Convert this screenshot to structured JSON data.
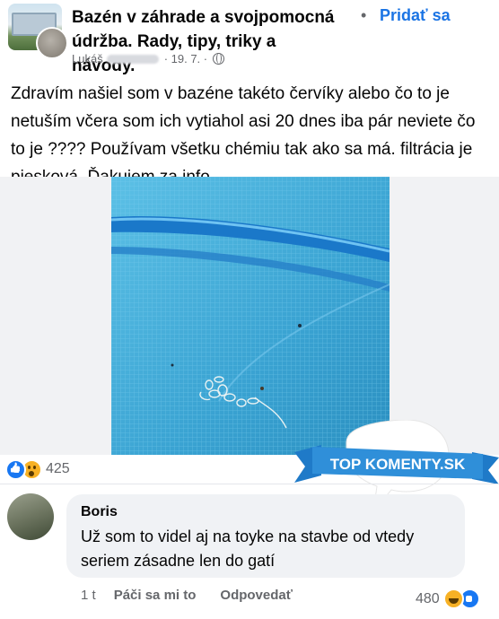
{
  "post": {
    "group_name": "Bazén v záhrade a svojpomocná údržba. Rady, tipy, triky a návody.",
    "join_separator": "•",
    "join_label": "Pridať sa",
    "author": "Lukáš",
    "date": "· 19. 7. ·",
    "body": "Zdravím našiel som v bazéne takéto červíky alebo čo to je netuším včera som ich vytiahol asi 20 dnes iba pár neviete čo to je ????  Používam všetku chémiu tak ako sa má. filtrácia je piesková.  Ďakujem za info ....",
    "reaction_count": "425"
  },
  "badge": {
    "text": "TOP KOMENTY.SK"
  },
  "comment": {
    "author": "Boris",
    "text": "Už som to videl aj na toyke na stavbe od vtedy seriem zásadne len do gatí",
    "time": "1 t",
    "like_label": "Páči sa mi to",
    "reply_label": "Odpovedať",
    "reaction_count": "480"
  },
  "icons": {
    "privacy": "globe-icon",
    "reactions": [
      "like-icon",
      "wow-icon"
    ],
    "comment_reactions": [
      "haha-icon",
      "like-icon"
    ]
  },
  "colors": {
    "accent": "#1b74e4",
    "like": "#1877f2",
    "emoji": "#f7b125",
    "bubble": "#f0f2f5",
    "muted": "#65676b"
  }
}
